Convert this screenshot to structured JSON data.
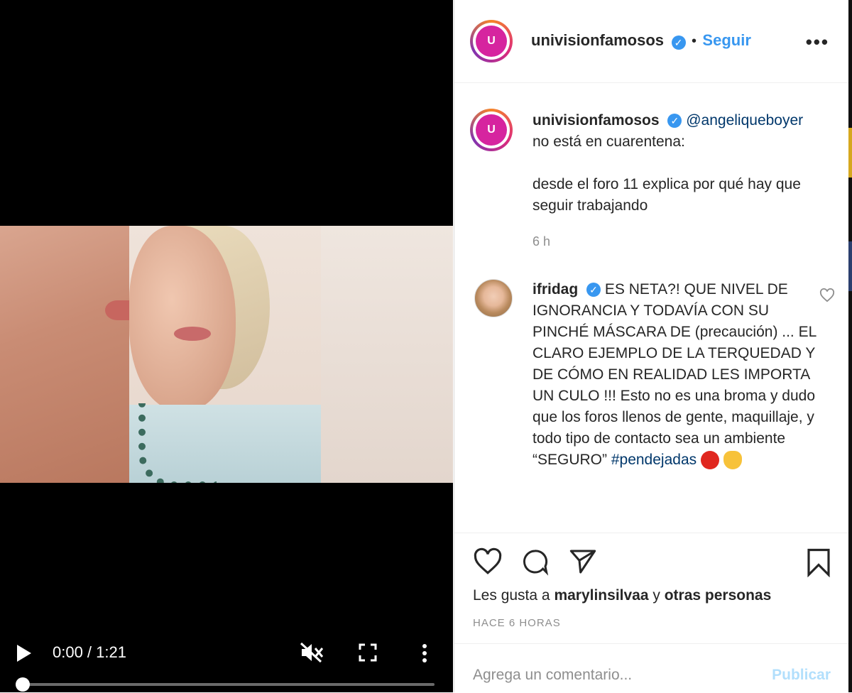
{
  "video": {
    "time": "0:00 / 1:21"
  },
  "header": {
    "username": "univisionfamosos",
    "separator": "•",
    "follow_label": "Seguir",
    "avatar_text": "U"
  },
  "caption": {
    "username": "univisionfamosos",
    "mention": "@angeliqueboyer",
    "line1": "no está en cuarentena:",
    "line2": "desde el foro 11 explica por qué hay que seguir trabajando",
    "timestamp": "6 h"
  },
  "comment": {
    "username": "ifridag",
    "text": "ES NETA?! QUE NIVEL DE IGNORANCIA Y TODAVÍA CON SU PINCHÉ MÁSCARA DE (precaución) ... EL CLARO EJEMPLO DE LA TERQUEDAD Y DE CÓMO EN REALIDAD LES IMPORTA UN CULO !!! Esto no es una broma y dudo que los foros llenos de gente, maquillaje, y todo tipo de contacto sea un ambiente “SEGURO”",
    "hashtag": "#pendejadas"
  },
  "likes": {
    "prefix": "Les gusta a",
    "user": "marylinsilvaa",
    "joiner": "y",
    "others": "otras personas"
  },
  "posted_ago": "HACE 6 HORAS",
  "add_comment": {
    "placeholder": "Agrega un comentario...",
    "publish_label": "Publicar"
  },
  "colors": {
    "accent": "#3897f0",
    "mention": "#00376b",
    "muted": "#8e8e8e",
    "publish_disabled": "#b2dffc"
  }
}
